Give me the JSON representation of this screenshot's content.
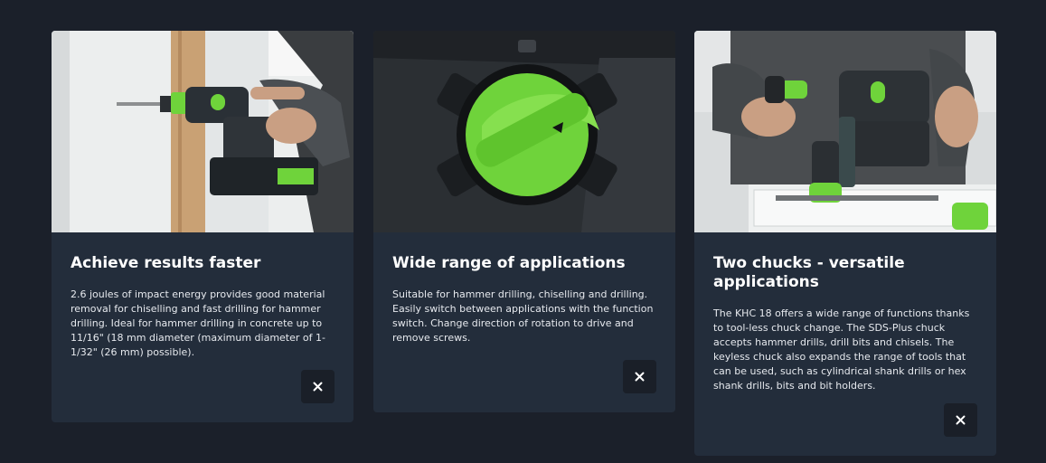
{
  "cards": [
    {
      "title": "Achieve results faster",
      "text": "2.6 joules of impact energy provides good material removal for chiselling and fast drilling for hammer drilling. Ideal for hammer drilling in concrete up to 11/16\" (18 mm diameter (maximum diameter of 1-1/32\" (26 mm) possible).",
      "image_alt": "Person drilling into a wall with a cordless rotary hammer",
      "close_icon": "close-icon"
    },
    {
      "title": "Wide range of applications",
      "text": "Suitable for hammer drilling, chiselling and drilling. Easily switch between applications with the function switch. Change direction of rotation to drive and remove screws.",
      "image_alt": "Close-up of green function switch dial",
      "close_icon": "close-icon"
    },
    {
      "title": "Two chucks - versatile applications",
      "text": "The KHC 18 offers a wide range of functions thanks to tool-less chuck change. The SDS-Plus chuck accepts hammer drills, drill bits and chisels. The keyless chuck also expands the range of tools that can be used, such as cylindrical shank drills or hex shank drills, bits and bit holders.",
      "image_alt": "Person changing chuck on rotary hammer above a systainer case",
      "close_icon": "close-icon"
    }
  ],
  "colors": {
    "page_bg": "#1b202a",
    "card_bg": "#232d3b",
    "button_bg": "#1a1f28",
    "accent_green": "#6fd33b"
  }
}
